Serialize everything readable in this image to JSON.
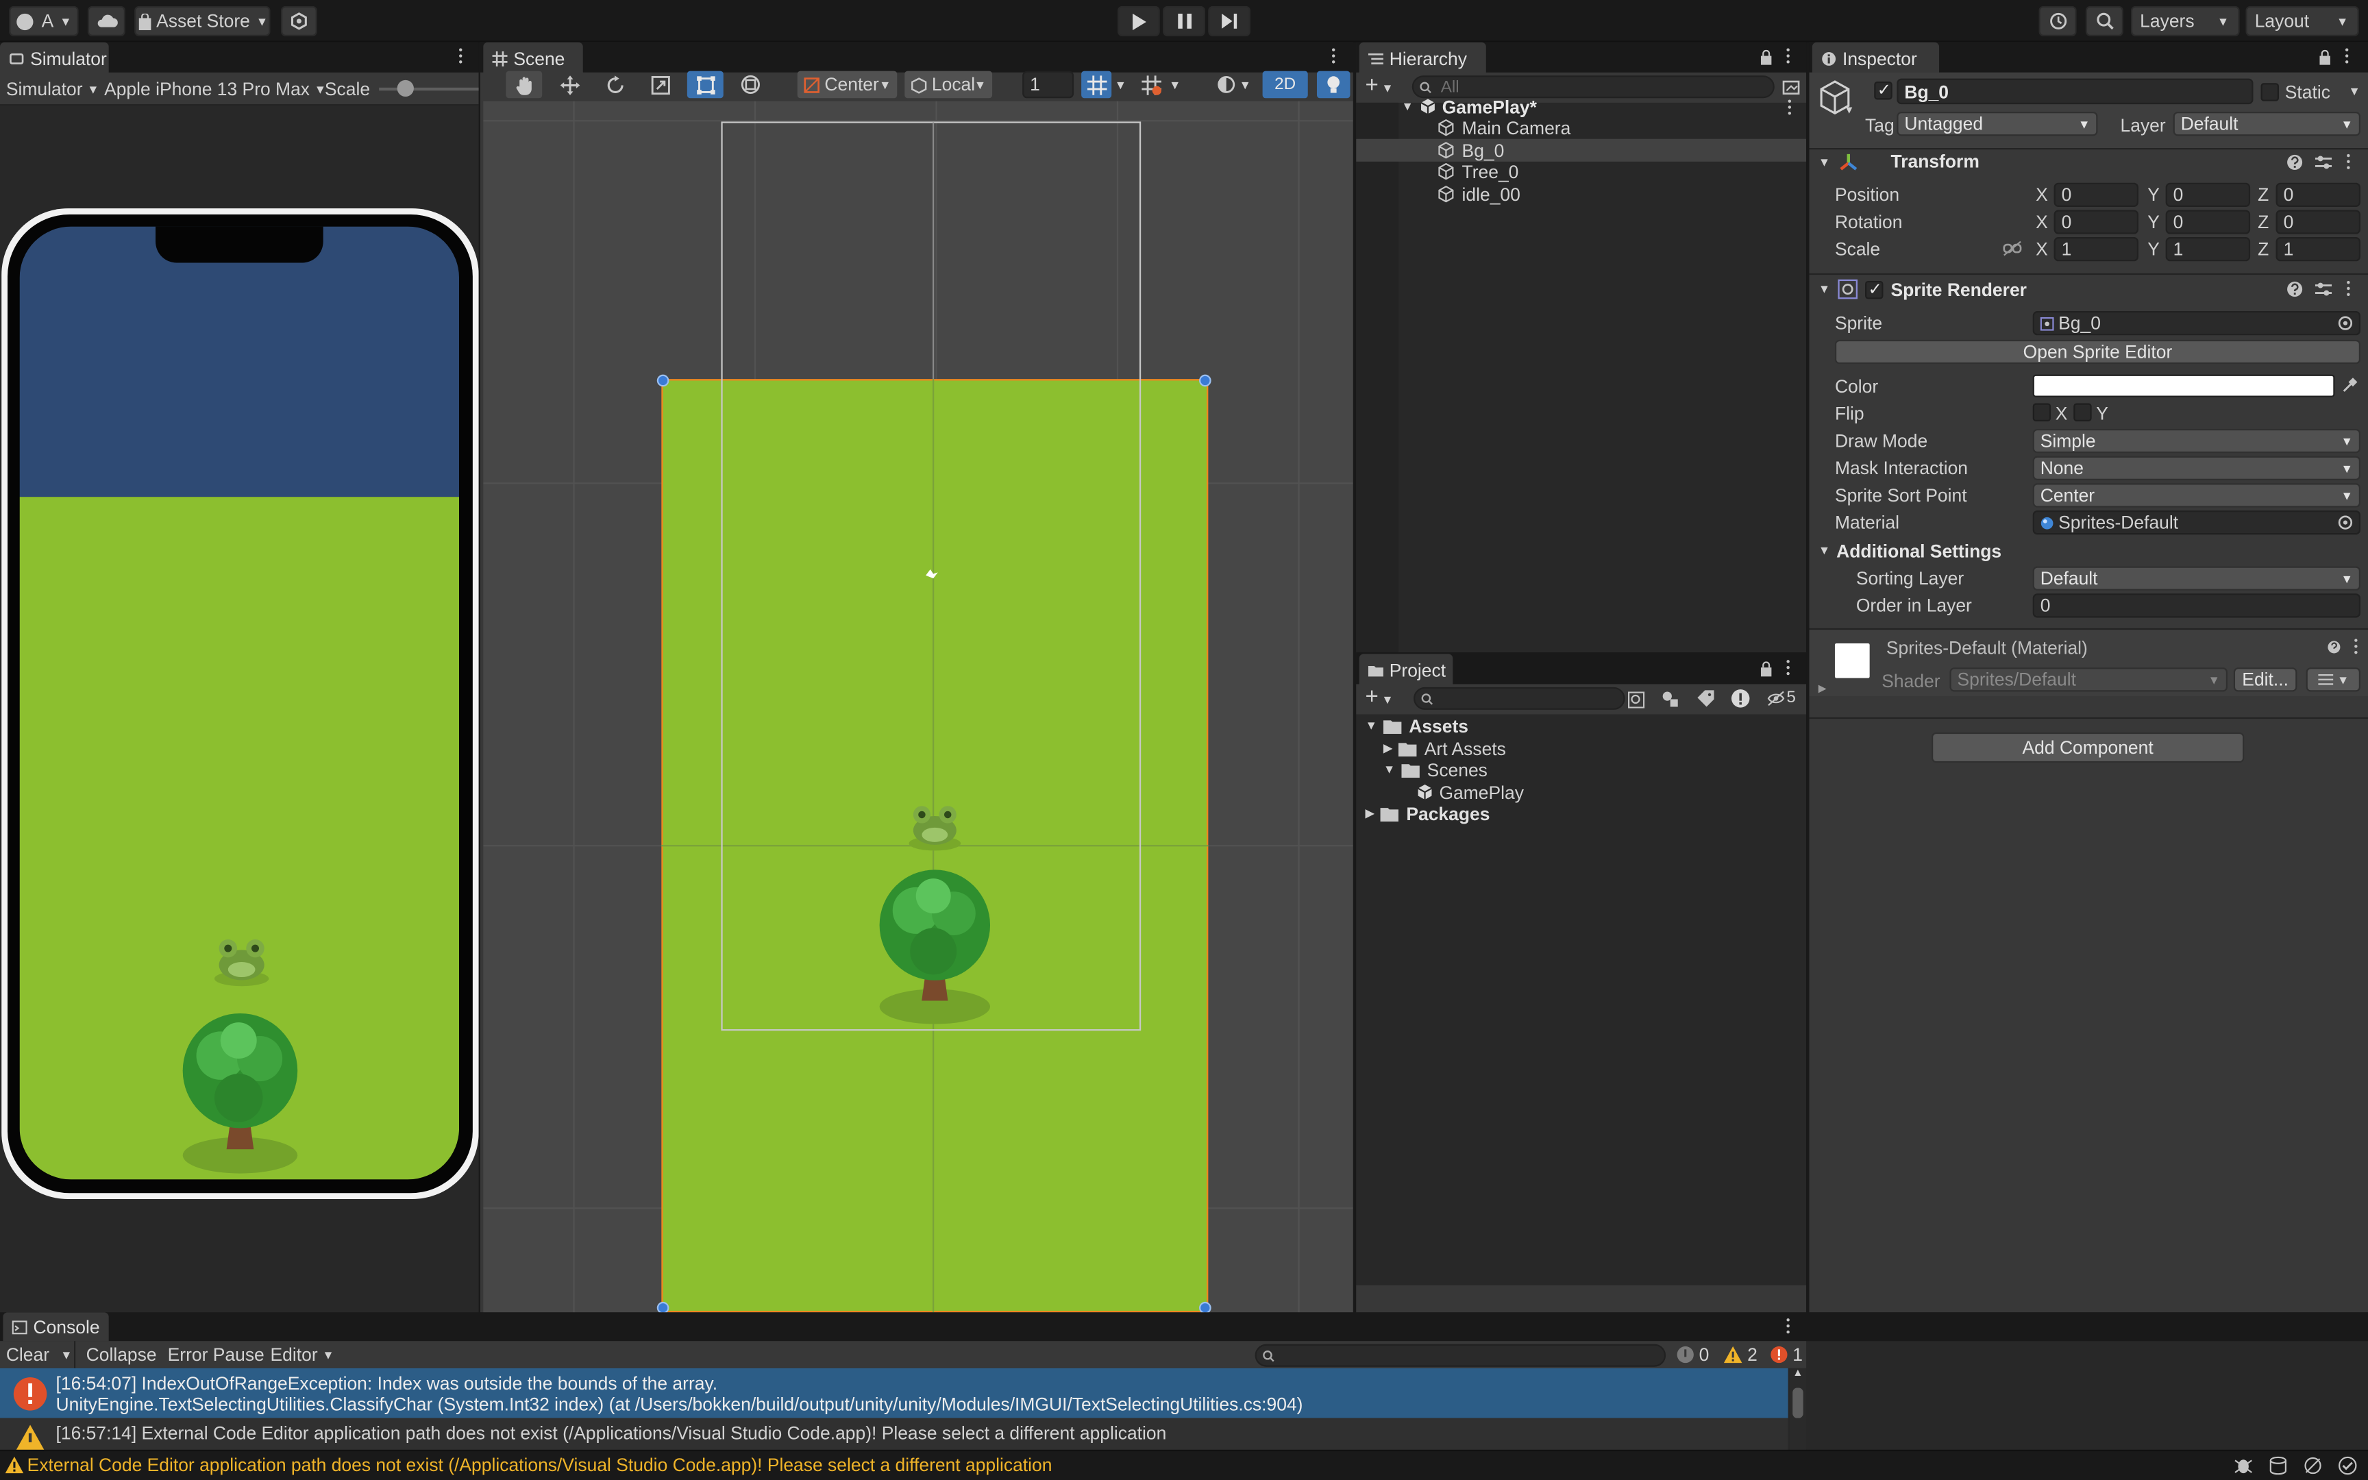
{
  "toolbar": {
    "account_label": "A",
    "asset_store_label": "Asset Store",
    "layers_label": "Layers",
    "layout_label": "Layout"
  },
  "simulator": {
    "tab_label": "Simulator",
    "mode_label": "Simulator",
    "device_label": "Apple iPhone 13 Pro Max",
    "scale_label": "Scale",
    "sky_color": "#2e4a74",
    "grass_color": "#8cbf2f"
  },
  "scene": {
    "tab_label": "Scene",
    "pivot_label": "Center",
    "space_label": "Local",
    "grid_value": "1",
    "mode_2d_label": "2D",
    "selection_color": "#f5821f",
    "grass_color": "#8cbf2f"
  },
  "hierarchy": {
    "tab_label": "Hierarchy",
    "search_placeholder": "All",
    "scene_name": "GamePlay*",
    "items": [
      {
        "label": "Main Camera"
      },
      {
        "label": "Bg_0"
      },
      {
        "label": "Tree_0"
      },
      {
        "label": "idle_00"
      }
    ]
  },
  "project": {
    "tab_label": "Project",
    "hidden_count": "5",
    "tree": [
      {
        "label": "Assets"
      },
      {
        "label": "Art Assets"
      },
      {
        "label": "Scenes"
      },
      {
        "label": "GamePlay"
      },
      {
        "label": "Packages"
      }
    ]
  },
  "inspector": {
    "tab_label": "Inspector",
    "object_name": "Bg_0",
    "static_label": "Static",
    "tag_label": "Tag",
    "tag_value": "Untagged",
    "layer_label": "Layer",
    "layer_value": "Default",
    "transform": {
      "title": "Transform",
      "position_label": "Position",
      "rotation_label": "Rotation",
      "scale_label": "Scale",
      "x": "X",
      "y": "Y",
      "z": "Z",
      "position": [
        "0",
        "0",
        "0"
      ],
      "rotation": [
        "0",
        "0",
        "0"
      ],
      "scale": [
        "1",
        "1",
        "1"
      ]
    },
    "sprite_renderer": {
      "title": "Sprite Renderer",
      "sprite_label": "Sprite",
      "sprite_value": "Bg_0",
      "open_editor_label": "Open Sprite Editor",
      "color_label": "Color",
      "color_value": "#ffffff",
      "flip_label": "Flip",
      "flip_x": "X",
      "flip_y": "Y",
      "draw_mode_label": "Draw Mode",
      "draw_mode_value": "Simple",
      "mask_label": "Mask Interaction",
      "mask_value": "None",
      "sort_point_label": "Sprite Sort Point",
      "sort_point_value": "Center",
      "material_label": "Material",
      "material_value": "Sprites-Default",
      "additional_label": "Additional Settings",
      "sorting_layer_label": "Sorting Layer",
      "sorting_layer_value": "Default",
      "order_label": "Order in Layer",
      "order_value": "0"
    },
    "material": {
      "title": "Sprites-Default (Material)",
      "shader_label": "Shader",
      "shader_value": "Sprites/Default",
      "edit_label": "Edit..."
    },
    "add_component_label": "Add Component"
  },
  "console": {
    "tab_label": "Console",
    "clear_label": "Clear",
    "collapse_label": "Collapse",
    "error_pause_label": "Error Pause",
    "editor_label": "Editor",
    "info_count": "0",
    "warning_count": "2",
    "error_count": "1",
    "entries": [
      {
        "line1": "[16:54:07] IndexOutOfRangeException: Index was outside the bounds of the array.",
        "line2": "UnityEngine.TextSelectingUtilities.ClassifyChar (System.Int32 index) (at /Users/bokken/build/output/unity/unity/Modules/IMGUI/TextSelectingUtilities.cs:904)"
      },
      {
        "line1": "[16:57:14] External Code Editor application path does not exist (/Applications/Visual Studio Code.app)! Please select a different application"
      }
    ]
  },
  "status_bar": {
    "message": "External Code Editor application path does not exist (/Applications/Visual Studio Code.app)! Please select a different application"
  }
}
